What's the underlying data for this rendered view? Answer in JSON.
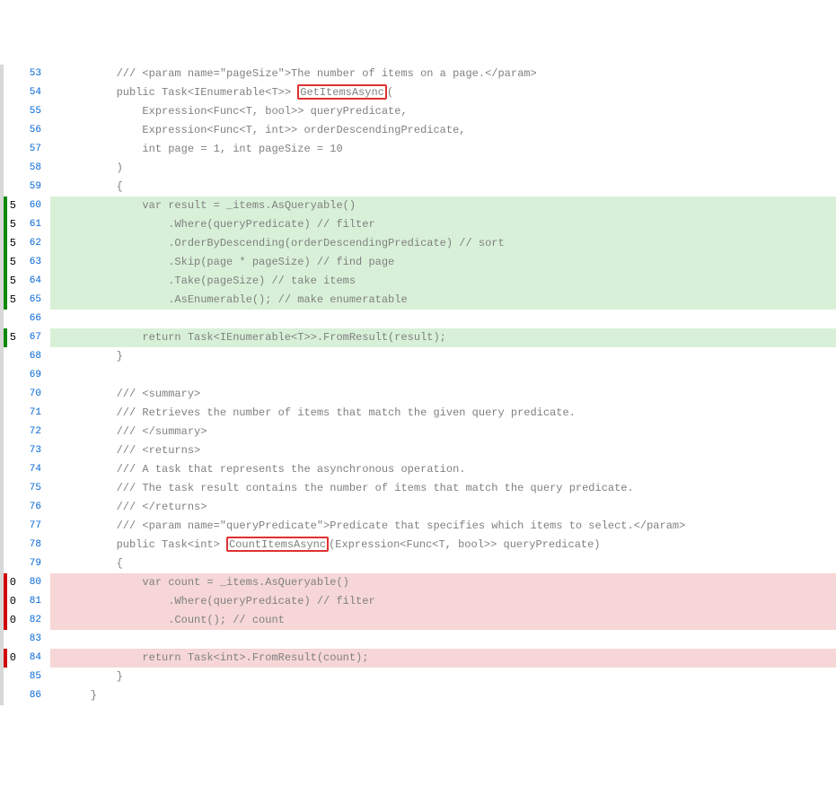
{
  "lines": [
    {
      "num": 53,
      "hits": null,
      "cov": "none",
      "code": "        /// <param name=\"pageSize\">The number of items on a page.</param>"
    },
    {
      "num": 54,
      "hits": null,
      "cov": "none",
      "code": "        public Task<IEnumerable<T>> ",
      "highlight": "GetItemsAsync",
      "code_after": "("
    },
    {
      "num": 55,
      "hits": null,
      "cov": "none",
      "code": "            Expression<Func<T, bool>> queryPredicate,"
    },
    {
      "num": 56,
      "hits": null,
      "cov": "none",
      "code": "            Expression<Func<T, int>> orderDescendingPredicate,"
    },
    {
      "num": 57,
      "hits": null,
      "cov": "none",
      "code": "            int page = 1, int pageSize = 10"
    },
    {
      "num": 58,
      "hits": null,
      "cov": "none",
      "code": "        )"
    },
    {
      "num": 59,
      "hits": null,
      "cov": "none",
      "code": "        {"
    },
    {
      "num": 60,
      "hits": "5",
      "cov": "covered",
      "code": "            var result = _items.AsQueryable()"
    },
    {
      "num": 61,
      "hits": "5",
      "cov": "covered",
      "code": "                .Where(queryPredicate) // filter"
    },
    {
      "num": 62,
      "hits": "5",
      "cov": "covered",
      "code": "                .OrderByDescending(orderDescendingPredicate) // sort"
    },
    {
      "num": 63,
      "hits": "5",
      "cov": "covered",
      "code": "                .Skip(page * pageSize) // find page"
    },
    {
      "num": 64,
      "hits": "5",
      "cov": "covered",
      "code": "                .Take(pageSize) // take items"
    },
    {
      "num": 65,
      "hits": "5",
      "cov": "covered",
      "code": "                .AsEnumerable(); // make enumeratable"
    },
    {
      "num": 66,
      "hits": null,
      "cov": "none",
      "code": ""
    },
    {
      "num": 67,
      "hits": "5",
      "cov": "covered",
      "code": "            return Task<IEnumerable<T>>.FromResult(result);"
    },
    {
      "num": 68,
      "hits": null,
      "cov": "none",
      "code": "        }"
    },
    {
      "num": 69,
      "hits": null,
      "cov": "none",
      "code": ""
    },
    {
      "num": 70,
      "hits": null,
      "cov": "none",
      "code": "        /// <summary>"
    },
    {
      "num": 71,
      "hits": null,
      "cov": "none",
      "code": "        /// Retrieves the number of items that match the given query predicate."
    },
    {
      "num": 72,
      "hits": null,
      "cov": "none",
      "code": "        /// </summary>"
    },
    {
      "num": 73,
      "hits": null,
      "cov": "none",
      "code": "        /// <returns>"
    },
    {
      "num": 74,
      "hits": null,
      "cov": "none",
      "code": "        /// A task that represents the asynchronous operation."
    },
    {
      "num": 75,
      "hits": null,
      "cov": "none",
      "code": "        /// The task result contains the number of items that match the query predicate."
    },
    {
      "num": 76,
      "hits": null,
      "cov": "none",
      "code": "        /// </returns>"
    },
    {
      "num": 77,
      "hits": null,
      "cov": "none",
      "code": "        /// <param name=\"queryPredicate\">Predicate that specifies which items to select.</param>"
    },
    {
      "num": 78,
      "hits": null,
      "cov": "none",
      "code": "        public Task<int> ",
      "highlight": "CountItemsAsync",
      "code_after": "(Expression<Func<T, bool>> queryPredicate)"
    },
    {
      "num": 79,
      "hits": null,
      "cov": "none",
      "code": "        {"
    },
    {
      "num": 80,
      "hits": "0",
      "cov": "uncovered",
      "code": "            var count = _items.AsQueryable()"
    },
    {
      "num": 81,
      "hits": "0",
      "cov": "uncovered",
      "code": "                .Where(queryPredicate) // filter"
    },
    {
      "num": 82,
      "hits": "0",
      "cov": "uncovered",
      "code": "                .Count(); // count"
    },
    {
      "num": 83,
      "hits": null,
      "cov": "none",
      "code": ""
    },
    {
      "num": 84,
      "hits": "0",
      "cov": "uncovered",
      "code": "            return Task<int>.FromResult(count);"
    },
    {
      "num": 85,
      "hits": null,
      "cov": "none",
      "code": "        }"
    },
    {
      "num": 86,
      "hits": null,
      "cov": "none",
      "code": "    }"
    }
  ]
}
